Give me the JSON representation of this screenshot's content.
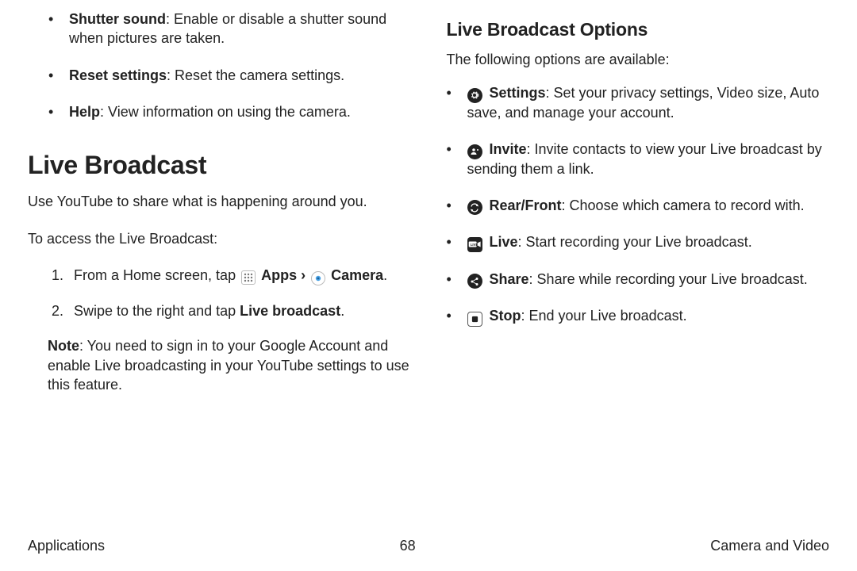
{
  "left": {
    "bullets": [
      {
        "label": "Shutter sound",
        "desc": ": Enable or disable a shutter sound when pictures are taken."
      },
      {
        "label": "Reset settings",
        "desc": ": Reset the camera settings."
      },
      {
        "label": "Help",
        "desc": ": View information on using the camera."
      }
    ],
    "title": "Live Broadcast",
    "intro": "Use YouTube to share what is happening around you.",
    "access_intro": "To access the Live Broadcast:",
    "step1_pre": "From a Home screen, tap ",
    "step1_apps": "Apps",
    "step1_sep": " › ",
    "step1_camera": "Camera",
    "step1_end": ".",
    "step2_pre": "Swipe to the right and tap ",
    "step2_bold": "Live broadcast",
    "step2_end": ".",
    "note_label": "Note",
    "note_text": ": You need to sign in to your Google Account and enable Live broadcasting in your YouTube settings to use this feature."
  },
  "right": {
    "title": "Live Broadcast Options",
    "intro": "The following options are available:",
    "options": [
      {
        "icon": "gear",
        "label": "Settings",
        "desc": ": Set your privacy settings, Video size, Auto save, and manage your account."
      },
      {
        "icon": "invite",
        "label": "Invite",
        "desc": ": Invite contacts to view your Live broadcast by sending them a link."
      },
      {
        "icon": "swap",
        "label": "Rear/Front",
        "desc": ": Choose which camera to record with."
      },
      {
        "icon": "live",
        "label": "Live",
        "desc": ": Start recording your Live broadcast."
      },
      {
        "icon": "share",
        "label": "Share",
        "desc": ": Share while recording your Live broadcast."
      },
      {
        "icon": "stop",
        "label": "Stop",
        "desc": ": End your Live broadcast."
      }
    ]
  },
  "footer": {
    "left": "Applications",
    "center": "68",
    "right": "Camera and Video"
  }
}
